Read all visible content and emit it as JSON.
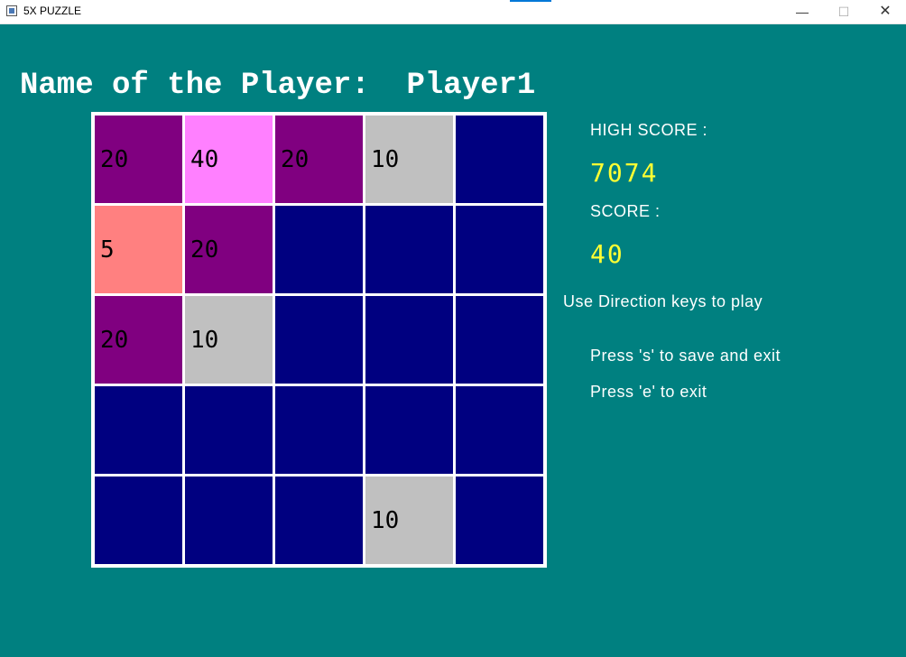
{
  "window": {
    "title": "5X PUZZLE",
    "min_glyph": "—",
    "max_glyph": "☐",
    "close_glyph": "✕"
  },
  "header": {
    "label": "Name of the Player:",
    "player": "Player1"
  },
  "board": {
    "rows": [
      [
        {
          "value": "20",
          "color": "#800080"
        },
        {
          "value": "40",
          "color": "#ff80ff"
        },
        {
          "value": "20",
          "color": "#800080"
        },
        {
          "value": "10",
          "color": "#c0c0c0"
        },
        {
          "value": "",
          "color": "#000080"
        }
      ],
      [
        {
          "value": "5",
          "color": "#ff8080"
        },
        {
          "value": "20",
          "color": "#800080"
        },
        {
          "value": "",
          "color": "#000080"
        },
        {
          "value": "",
          "color": "#000080"
        },
        {
          "value": "",
          "color": "#000080"
        }
      ],
      [
        {
          "value": "20",
          "color": "#800080"
        },
        {
          "value": "10",
          "color": "#c0c0c0"
        },
        {
          "value": "",
          "color": "#000080"
        },
        {
          "value": "",
          "color": "#000080"
        },
        {
          "value": "",
          "color": "#000080"
        }
      ],
      [
        {
          "value": "",
          "color": "#000080"
        },
        {
          "value": "",
          "color": "#000080"
        },
        {
          "value": "",
          "color": "#000080"
        },
        {
          "value": "",
          "color": "#000080"
        },
        {
          "value": "",
          "color": "#000080"
        }
      ],
      [
        {
          "value": "",
          "color": "#000080"
        },
        {
          "value": "",
          "color": "#000080"
        },
        {
          "value": "",
          "color": "#000080"
        },
        {
          "value": "10",
          "color": "#c0c0c0"
        },
        {
          "value": "",
          "color": "#000080"
        }
      ]
    ]
  },
  "side": {
    "high_score_label": "HIGH SCORE :",
    "high_score": "7074",
    "score_label": "SCORE :",
    "score": "40",
    "instructions": "Use Direction keys to play",
    "save_hint": "Press 's' to save and exit",
    "exit_hint": "Press 'e' to exit"
  },
  "colors": {
    "background": "#008080",
    "empty": "#000080",
    "score_text": "#ffff33"
  }
}
